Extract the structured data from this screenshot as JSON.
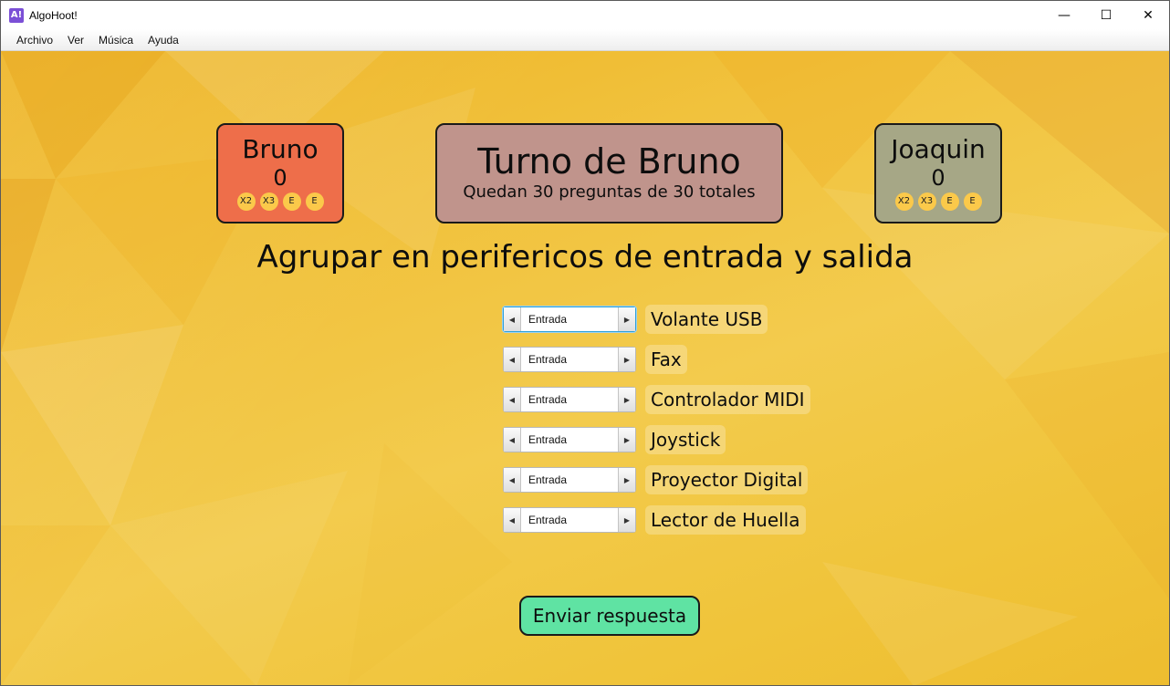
{
  "window": {
    "title": "AlgoHoot!",
    "icon_label": "A!",
    "controls": {
      "minimize": "—",
      "maximize": "☐",
      "close": "✕"
    }
  },
  "menu": [
    "Archivo",
    "Ver",
    "Música",
    "Ayuda"
  ],
  "players": [
    {
      "name": "Bruno",
      "score": "0",
      "powerups": [
        "X2",
        "X3",
        "E",
        "E"
      ],
      "color": "#ee6e4a"
    },
    {
      "name": "Joaquin",
      "score": "0",
      "powerups": [
        "X2",
        "X3",
        "E",
        "E"
      ],
      "color": "#a6a786"
    }
  ],
  "turn": {
    "title": "Turno de Bruno",
    "subtitle": "Quedan 30 preguntas de 30 totales"
  },
  "question": {
    "text": "Agrupar en perifericos de entrada y salida"
  },
  "items": [
    {
      "value": "Entrada",
      "label": "Volante USB"
    },
    {
      "value": "Entrada",
      "label": "Fax"
    },
    {
      "value": "Entrada",
      "label": "Controlador MIDI"
    },
    {
      "value": "Entrada",
      "label": "Joystick"
    },
    {
      "value": "Entrada",
      "label": "Proyector Digital"
    },
    {
      "value": "Entrada",
      "label": "Lector de Huella"
    }
  ],
  "submit": {
    "label": "Enviar respuesta"
  },
  "colors": {
    "background": "#f1c23d",
    "submit": "#5fe3a3",
    "turn_card": "#c0948c"
  }
}
